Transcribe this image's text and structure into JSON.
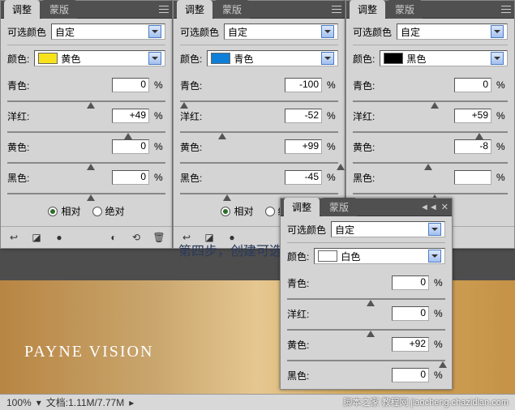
{
  "tabs": {
    "adjust": "调整",
    "mask": "蒙版"
  },
  "labels": {
    "selective_color": "可选颜色",
    "custom": "自定",
    "colors": "颜色:",
    "cyan": "青色:",
    "magenta": "洋红:",
    "yellow": "黄色:",
    "black": "黑色:",
    "relative": "相对",
    "absolute": "绝对",
    "pct": "%"
  },
  "panels": [
    {
      "id": "yellow",
      "swatch_label": "黄色",
      "swatch_color": "#f7e21b",
      "cyan": "0",
      "magenta": "+49",
      "yellow": "0",
      "black": "0"
    },
    {
      "id": "cyan",
      "swatch_label": "青色",
      "swatch_color": "#0e7fd8",
      "cyan": "-100",
      "magenta": "-52",
      "yellow": "+99",
      "black": "-45"
    },
    {
      "id": "black",
      "swatch_label": "黑色",
      "swatch_color": "#000000",
      "cyan": "0",
      "magenta": "+59",
      "yellow": "-8",
      "black": ""
    },
    {
      "id": "white",
      "swatch_label": "白色",
      "swatch_color": "#ffffff",
      "cyan": "0",
      "magenta": "0",
      "yellow": "+92",
      "black": "0"
    }
  ],
  "caption": "第四步，创建可选颜色调整层，参数如图",
  "watermark": "PAYNE VISION",
  "status": {
    "zoom": "100%",
    "doc": "文档:1.11M/7.77M"
  },
  "credit": "脚本之家 教程网 jiaocheng.chazidian.com"
}
